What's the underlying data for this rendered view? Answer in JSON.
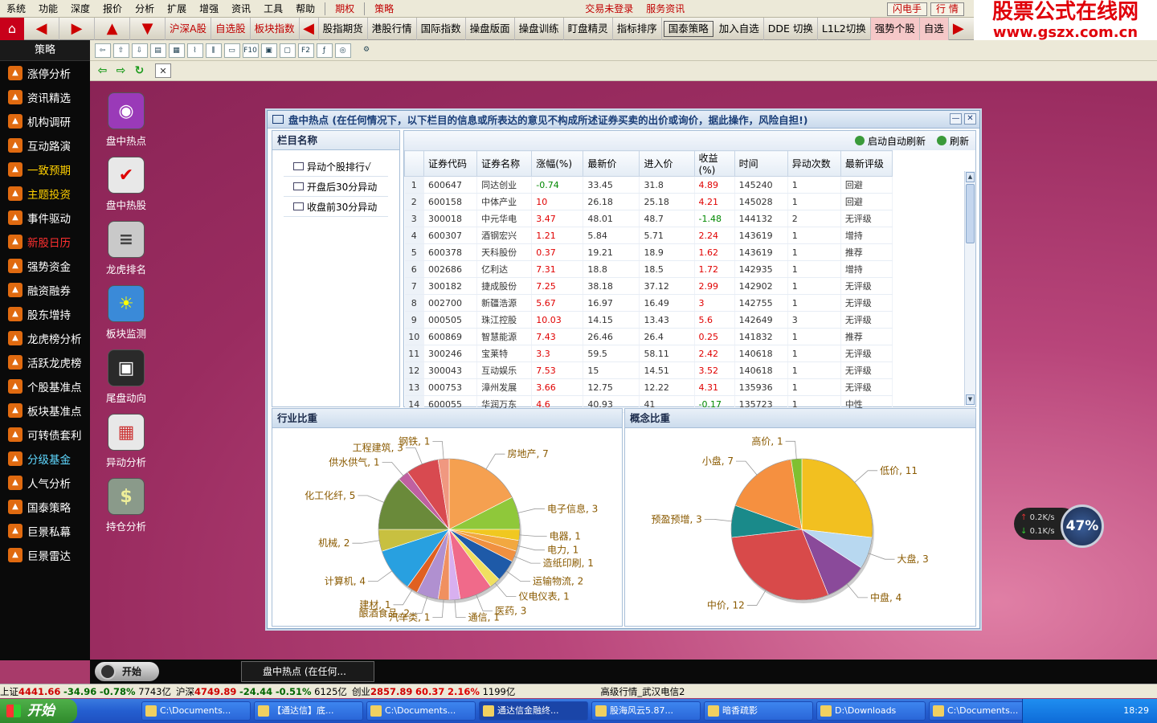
{
  "menu": {
    "items": [
      "系统",
      "功能",
      "深度",
      "报价",
      "分析",
      "扩展",
      "增强",
      "资讯",
      "工具",
      "帮助"
    ],
    "qiquan": "期权",
    "celue": "策略",
    "login_status": "交易未登录",
    "service_news": "服务资讯",
    "flash_trade": "闪电手",
    "market": "行 情"
  },
  "brand": {
    "line1": "股票公式在线网",
    "line2": "www.gszx.com.cn"
  },
  "nav": {
    "tabs": [
      "沪深A股",
      "自选股",
      "板块指数",
      "股指期货",
      "港股行情",
      "国际指数",
      "操盘版面",
      "操盘训练",
      "盯盘精灵",
      "指标排序",
      "国泰策略",
      "加入自选",
      "DDE 切换",
      "L1L2切换",
      "强势个股",
      "自选"
    ]
  },
  "toolbar": {
    "icons": [
      "F10",
      "F2"
    ]
  },
  "sidebar": {
    "title": "策略",
    "items": [
      {
        "label": "涨停分析",
        "color": "white"
      },
      {
        "label": "资讯精选",
        "color": "white"
      },
      {
        "label": "机构调研",
        "color": "white"
      },
      {
        "label": "互动路演",
        "color": "white"
      },
      {
        "label": "一致预期",
        "color": "yellow"
      },
      {
        "label": "主题投资",
        "color": "yellow"
      },
      {
        "label": "事件驱动",
        "color": "white"
      },
      {
        "label": "新股日历",
        "color": "red"
      },
      {
        "label": "强势资金",
        "color": "white"
      },
      {
        "label": "融资融券",
        "color": "white"
      },
      {
        "label": "股东增持",
        "color": "white"
      },
      {
        "label": "龙虎榜分析",
        "color": "white"
      },
      {
        "label": "活跃龙虎榜",
        "color": "white"
      },
      {
        "label": "个股基准点",
        "color": "white"
      },
      {
        "label": "板块基准点",
        "color": "white"
      },
      {
        "label": "可转债套利",
        "color": "white"
      },
      {
        "label": "分级基金",
        "color": "cyan"
      },
      {
        "label": "人气分析",
        "color": "white"
      },
      {
        "label": "国泰策略",
        "color": "white"
      },
      {
        "label": "巨景私幕",
        "color": "white"
      },
      {
        "label": "巨景雷达",
        "color": "white"
      }
    ]
  },
  "desktop_icons": [
    {
      "label": "盘中热点",
      "icon": "headset-icon",
      "bg": "#9a3ab8"
    },
    {
      "label": "盘中热股",
      "icon": "todolist-icon",
      "bg": "#e8e8e8"
    },
    {
      "label": "龙虎排名",
      "icon": "database-icon",
      "bg": "#c9c9c9"
    },
    {
      "label": "板块监测",
      "icon": "weather-icon",
      "bg": "#3a8ad8"
    },
    {
      "label": "尾盘动向",
      "icon": "map-icon",
      "bg": "#2a2a2a"
    },
    {
      "label": "异动分析",
      "icon": "calendar-icon",
      "bg": "#e8e8e8"
    },
    {
      "label": "持仓分析",
      "icon": "dollar-icon",
      "bg": "#8a9a8a"
    }
  ],
  "window": {
    "title": "盘中热点 (在任何情况下，以下栏目的信息或所表达的意见不构成所述证券买卖的出价或询价，据此操作，风险自担!)",
    "column_panel": {
      "title": "栏目名称",
      "items": [
        "异动个股排行√",
        "开盘后30分异动",
        "收盘前30分异动"
      ]
    },
    "grid_toolbar": {
      "auto_refresh": "启动自动刷新",
      "refresh": "刷新"
    },
    "table": {
      "headers": [
        "证券代码",
        "证券名称",
        "涨幅(%)",
        "最新价",
        "进入价",
        "收益(%)",
        "时间",
        "异动次数",
        "最新评级"
      ],
      "rows": [
        [
          "1",
          "600647",
          "同达创业",
          "-0.74",
          "33.45",
          "31.8",
          "4.89",
          "145240",
          "1",
          "回避"
        ],
        [
          "2",
          "600158",
          "中体产业",
          "10",
          "26.18",
          "25.18",
          "4.21",
          "145028",
          "1",
          "回避"
        ],
        [
          "3",
          "300018",
          "中元华电",
          "3.47",
          "48.01",
          "48.7",
          "-1.48",
          "144132",
          "2",
          "无评级"
        ],
        [
          "4",
          "600307",
          "酒钢宏兴",
          "1.21",
          "5.84",
          "5.71",
          "2.24",
          "143619",
          "1",
          "增持"
        ],
        [
          "5",
          "600378",
          "天科股份",
          "0.37",
          "19.21",
          "18.9",
          "1.62",
          "143619",
          "1",
          "推荐"
        ],
        [
          "6",
          "002686",
          "亿利达",
          "7.31",
          "18.8",
          "18.5",
          "1.72",
          "142935",
          "1",
          "增持"
        ],
        [
          "7",
          "300182",
          "捷成股份",
          "7.25",
          "38.18",
          "37.12",
          "2.99",
          "142902",
          "1",
          "无评级"
        ],
        [
          "8",
          "002700",
          "新疆浩源",
          "5.67",
          "16.97",
          "16.49",
          "3",
          "142755",
          "1",
          "无评级"
        ],
        [
          "9",
          "000505",
          "珠江控股",
          "10.03",
          "14.15",
          "13.43",
          "5.6",
          "142649",
          "3",
          "无评级"
        ],
        [
          "10",
          "600869",
          "智慧能源",
          "7.43",
          "26.46",
          "26.4",
          "0.25",
          "141832",
          "1",
          "推荐"
        ],
        [
          "11",
          "300246",
          "宝莱特",
          "3.3",
          "59.5",
          "58.11",
          "2.42",
          "140618",
          "1",
          "无评级"
        ],
        [
          "12",
          "300043",
          "互动娱乐",
          "7.53",
          "15",
          "14.51",
          "3.52",
          "140618",
          "1",
          "无评级"
        ],
        [
          "13",
          "000753",
          "漳州发展",
          "3.66",
          "12.75",
          "12.22",
          "4.31",
          "135936",
          "1",
          "无评级"
        ],
        [
          "14",
          "600055",
          "华润万东",
          "4.6",
          "40.93",
          "41",
          "-0.17",
          "135723",
          "1",
          "中性"
        ]
      ]
    },
    "industry_panel": {
      "title": "行业比重"
    },
    "concept_panel": {
      "title": "概念比重"
    }
  },
  "chart_data": [
    {
      "type": "pie",
      "title": "行业比重",
      "labels": [
        "房地产",
        "电子信息",
        "电器",
        "电力",
        "造纸印刷",
        "运输物流",
        "仪电仪表",
        "医药",
        "通信",
        "汽车类",
        "酿酒食品",
        "建材",
        "计算机",
        "机械",
        "化工化纤",
        "供水供气",
        "工程建筑",
        "钢铁"
      ],
      "values": [
        7,
        3,
        1,
        1,
        1,
        2,
        1,
        3,
        1,
        1,
        2,
        1,
        4,
        2,
        5,
        1,
        3,
        1
      ],
      "colors": [
        "#f5a050",
        "#8fc83a",
        "#f0c820",
        "#f2a840",
        "#f09040",
        "#1e5aa8",
        "#f0e060",
        "#f06a8a",
        "#d8b0f0",
        "#f09060",
        "#b090d0",
        "#e06020",
        "#28a0e0",
        "#c8c040",
        "#6a8a3a",
        "#c060a0",
        "#d84a50",
        "#f09880"
      ]
    },
    {
      "type": "pie",
      "title": "概念比重",
      "labels": [
        "低价",
        "大盘",
        "中盘",
        "中价",
        "预盈预增",
        "小盘",
        "高价"
      ],
      "values": [
        11,
        3,
        4,
        12,
        3,
        7,
        1
      ],
      "colors": [
        "#f2c020",
        "#b8d8f0",
        "#8a4a9a",
        "#d84a4a",
        "#1a8a8a",
        "#f59040",
        "#80c030"
      ]
    }
  ],
  "speed_widget": {
    "up": "0.2K/s",
    "down": "0.1K/s",
    "percent": "47%"
  },
  "startbar": {
    "start_label": "开始",
    "task_label": "盘中热点 (在任何..."
  },
  "status": {
    "sh_label": "上证",
    "sh_val": "4441.66",
    "sh_chg": "-34.96",
    "sh_pct": "-0.78%",
    "sh_amt": "7743亿",
    "hs_label": "沪深",
    "hs_val": "4749.89",
    "hs_chg": "-24.44",
    "hs_pct": "-0.51%",
    "hs_amt": "6125亿",
    "cy_label": "创业",
    "cy_val": "2857.89",
    "cy_chg": "60.37",
    "cy_pct": "2.16%",
    "cy_amt": "1199亿",
    "server": "高级行情_武汉电信2"
  },
  "xp_taskbar": {
    "start": "开始",
    "buttons": [
      "C:\\Documents...",
      "【通达信】底...",
      "C:\\Documents...",
      "通达信金融终...",
      "股海风云5.87...",
      "暗香疏影",
      "D:\\Downloads",
      "C:\\Documents..."
    ],
    "clock": "18:29"
  }
}
